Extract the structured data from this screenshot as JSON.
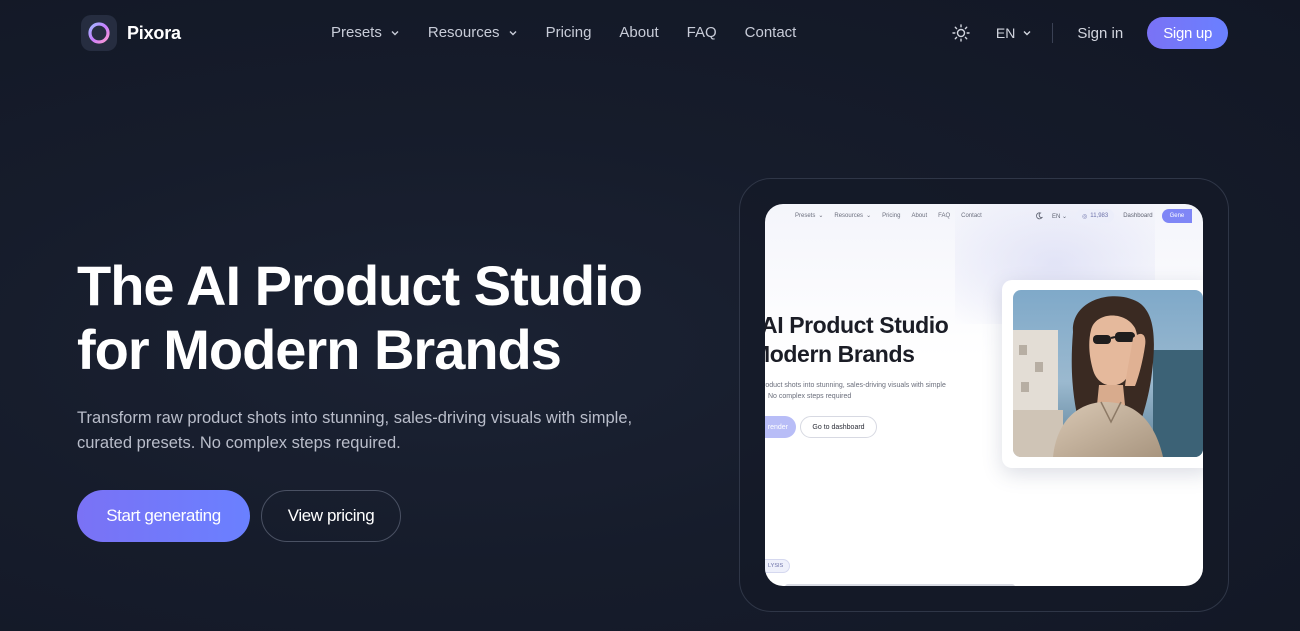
{
  "brand": {
    "name": "Pixora"
  },
  "nav": {
    "items": [
      {
        "label": "Presets",
        "dropdown": true
      },
      {
        "label": "Resources",
        "dropdown": true
      },
      {
        "label": "Pricing",
        "dropdown": false
      },
      {
        "label": "About",
        "dropdown": false
      },
      {
        "label": "FAQ",
        "dropdown": false
      },
      {
        "label": "Contact",
        "dropdown": false
      }
    ],
    "theme_icon": "sun-icon",
    "language": "EN",
    "sign_in": "Sign in",
    "sign_up": "Sign up"
  },
  "hero": {
    "title_line1": "The AI Product Studio",
    "title_line2": "for Modern Brands",
    "subtitle": "Transform raw product shots into stunning, sales-driving visuals with simple, curated presets. No complex steps required.",
    "cta_primary": "Start generating",
    "cta_secondary": "View pricing"
  },
  "preview": {
    "nav_items": [
      "Presets",
      "Resources",
      "Pricing",
      "About",
      "FAQ",
      "Contact"
    ],
    "language": "EN",
    "credits": "11,983",
    "dashboard": "Dashboard",
    "generate": "Gene",
    "title_line1": "AI Product Studio",
    "title_line2": "Modern Brands",
    "subtitle_line1": "roduct shots into stunning, sales-driving visuals with simple",
    "subtitle_line2": "No complex steps required",
    "btn_primary": "render",
    "btn_secondary": "Go to dashboard",
    "tag": "LYSIS"
  },
  "colors": {
    "accent_start": "#7a72f5",
    "accent_end": "#6a80ff",
    "background": "#161c2b"
  }
}
